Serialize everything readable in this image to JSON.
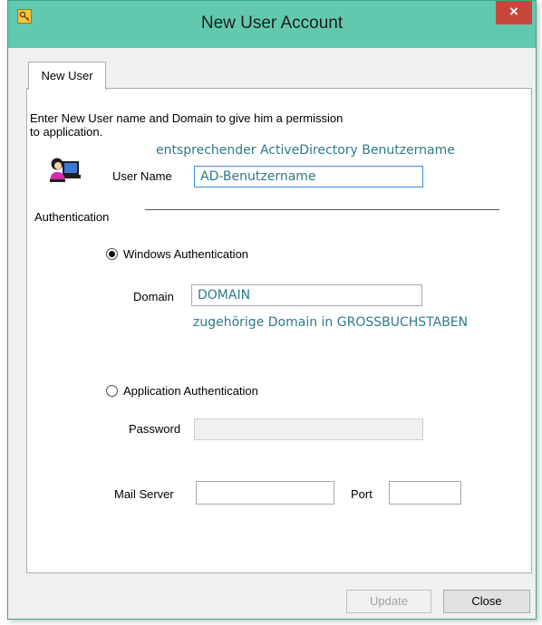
{
  "window": {
    "title": "New User Account",
    "close_symbol": "×",
    "app_icon": "key-icon"
  },
  "tabs": [
    {
      "label": "New User",
      "active": true
    }
  ],
  "intro_text_line1": "Enter New User name and Domain to give him a permission",
  "intro_text_line2": "to application.",
  "user_name": {
    "label": "User Name",
    "value": "AD-Benutzername",
    "hint": "entsprechender ActiveDirectory Benutzername",
    "icon": "user-at-computer-icon"
  },
  "authentication": {
    "group_label": "Authentication",
    "windows": {
      "label": "Windows Authentication",
      "selected": true
    },
    "domain": {
      "label": "Domain",
      "value": "DOMAIN",
      "hint": "zugehörige Domain in GROSSBUCHSTABEN"
    },
    "application": {
      "label": "Application Authentication",
      "selected": false
    },
    "password": {
      "label": "Password",
      "value": ""
    }
  },
  "mail": {
    "server_label": "Mail Server",
    "server_value": "",
    "port_label": "Port",
    "port_value": ""
  },
  "buttons": {
    "update": "Update",
    "close": "Close"
  },
  "colors": {
    "titlebar": "#62c9ae",
    "hint_text": "#2e7a86",
    "close_button": "#c7453a"
  }
}
